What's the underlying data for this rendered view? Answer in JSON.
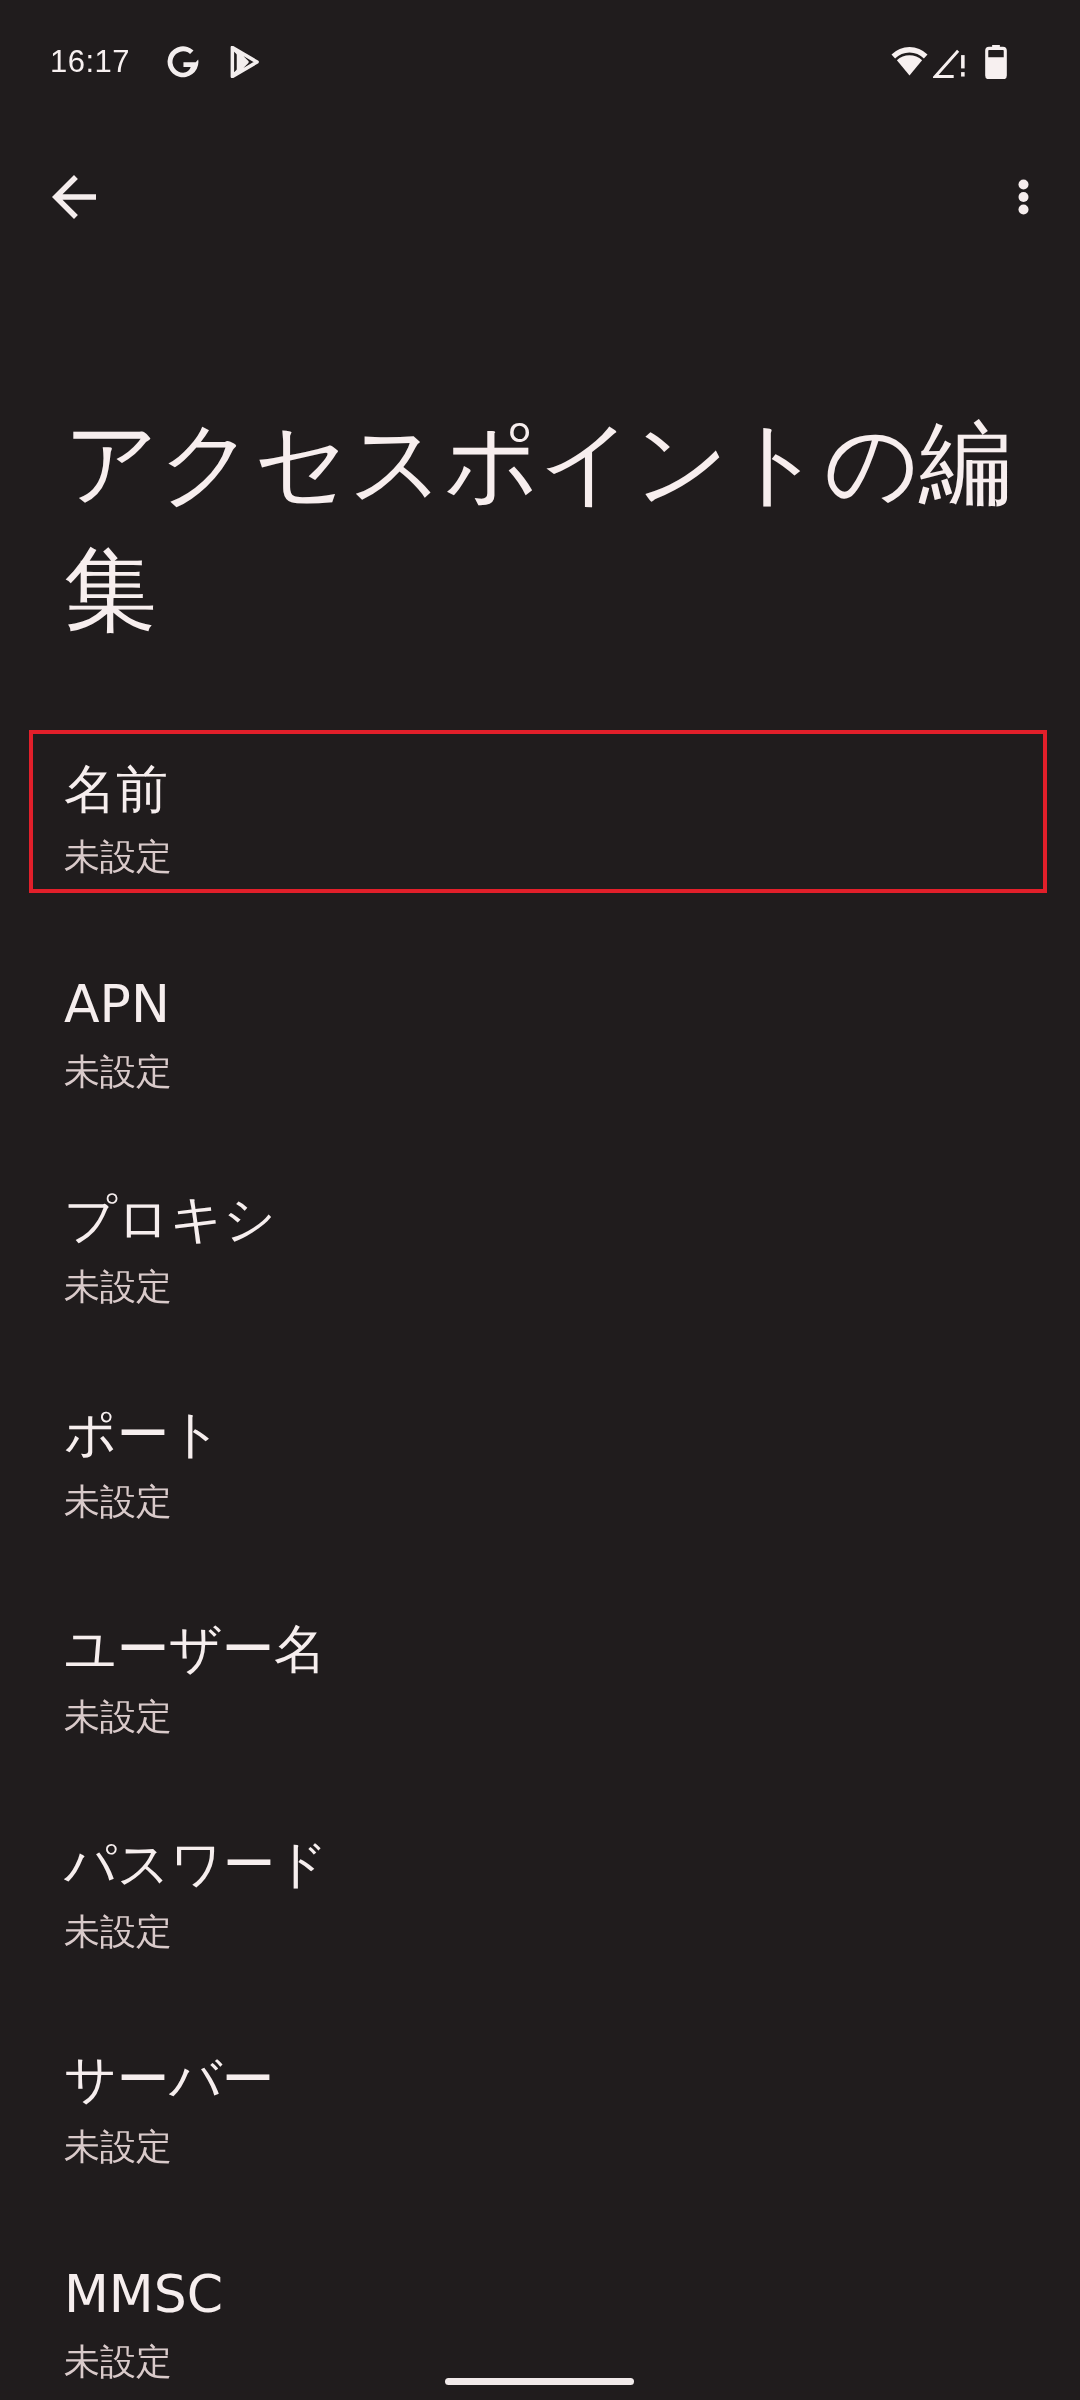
{
  "status_bar": {
    "time": "16:17"
  },
  "title": "アクセスポイントの編集",
  "settings": [
    {
      "title": "名前",
      "summary": "未設定",
      "highlighted": true
    },
    {
      "title": "APN",
      "summary": "未設定",
      "highlighted": false
    },
    {
      "title": "プロキシ",
      "summary": "未設定",
      "highlighted": false
    },
    {
      "title": "ポート",
      "summary": "未設定",
      "highlighted": false
    },
    {
      "title": "ユーザー名",
      "summary": "未設定",
      "highlighted": false
    },
    {
      "title": "パスワード",
      "summary": "未設定",
      "highlighted": false
    },
    {
      "title": "サーバー",
      "summary": "未設定",
      "highlighted": false
    },
    {
      "title": "MMSC",
      "summary": "未設定",
      "highlighted": false
    }
  ]
}
